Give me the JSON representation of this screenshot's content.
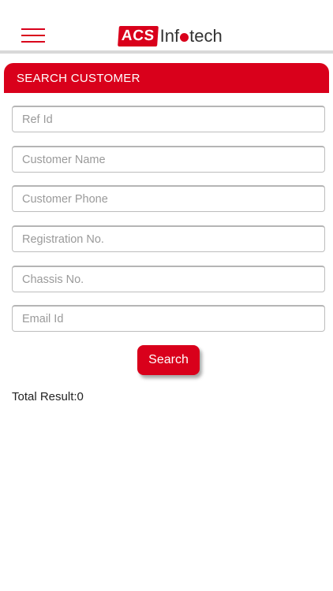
{
  "header": {
    "menu_icon": "hamburger-menu-icon",
    "logo": {
      "mark": "ACS",
      "text_before": "Inf",
      "text_after": "tech"
    }
  },
  "panel": {
    "title": "SEARCH CUSTOMER"
  },
  "form": {
    "ref_id": {
      "placeholder": "Ref Id",
      "value": ""
    },
    "customer_name": {
      "placeholder": "Customer Name",
      "value": ""
    },
    "customer_phone": {
      "placeholder": "Customer Phone",
      "value": ""
    },
    "registration_no": {
      "placeholder": "Registration No.",
      "value": ""
    },
    "chassis_no": {
      "placeholder": "Chassis No.",
      "value": ""
    },
    "email_id": {
      "placeholder": "Email Id",
      "value": ""
    },
    "search_label": "Search"
  },
  "result": {
    "total_text": "Total Result:0"
  },
  "colors": {
    "accent": "#d9001b",
    "divider": "#d9d9d9"
  }
}
